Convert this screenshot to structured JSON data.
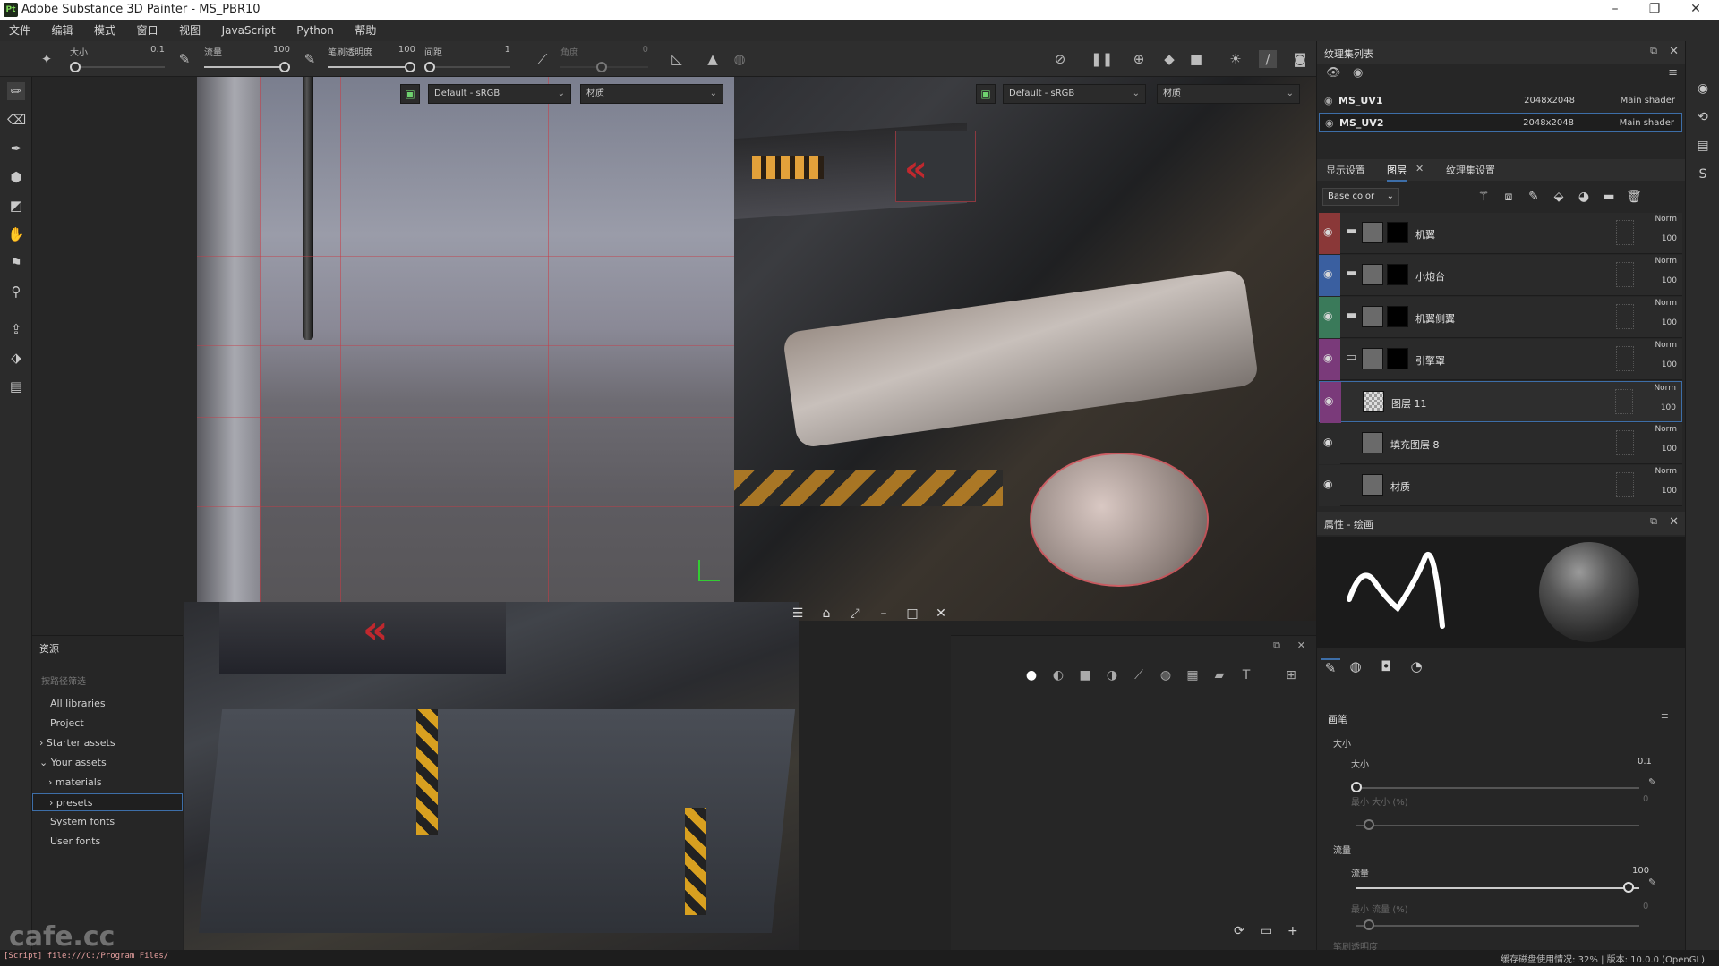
{
  "window": {
    "title": "Adobe Substance 3D Painter - MS_PBR10",
    "app_badge": "Pt",
    "min": "–",
    "max": "❐",
    "close": "✕"
  },
  "menu": [
    "文件",
    "编辑",
    "模式",
    "窗口",
    "视图",
    "JavaScript",
    "Python",
    "帮助"
  ],
  "toolbar": {
    "size_label": "大小",
    "size_value": "0.1",
    "flow_label": "流量",
    "flow_value": "100",
    "opacity_label": "笔刷透明度",
    "opacity_value": "100",
    "spacing_label": "间距",
    "spacing_value": "1",
    "angle_label": "角度",
    "angle_value": "0"
  },
  "viewport_2d": {
    "colorspace": "Default - sRGB",
    "channel": "材质"
  },
  "viewport_3d": {
    "colorspace": "Default - sRGB",
    "channel": "材质"
  },
  "assets": {
    "title": "资源",
    "filter_placeholder": "按路径筛选",
    "items": [
      "All libraries",
      "Project",
      "Starter assets",
      "Your assets",
      "materials",
      "presets",
      "System fonts",
      "User fonts"
    ]
  },
  "texture_sets": {
    "title": "纹理集列表",
    "rows": [
      {
        "name": "MS_UV1",
        "resolution": "2048x2048",
        "shader": "Main shader"
      },
      {
        "name": "MS_UV2",
        "resolution": "2048x2048",
        "shader": "Main shader"
      }
    ]
  },
  "layer_tabs": [
    "显示设置",
    "图层",
    "纹理集设置"
  ],
  "channel_select": "Base color",
  "layers": [
    {
      "name": "机翼",
      "blend": "Norm",
      "opacity": "100",
      "tag": "#8a3838",
      "type": "folder"
    },
    {
      "name": "小炮台",
      "blend": "Norm",
      "opacity": "100",
      "tag": "#3a5fa0",
      "type": "folder"
    },
    {
      "name": "机翼侧翼",
      "blend": "Norm",
      "opacity": "100",
      "tag": "#3a7a5a",
      "type": "folder"
    },
    {
      "name": "引擎罩",
      "blend": "Norm",
      "opacity": "100",
      "tag": "#7a3a7a",
      "type": "folder-open"
    },
    {
      "name": "图层 11",
      "blend": "Norm",
      "opacity": "100",
      "tag": "#7a3a7a",
      "type": "paint"
    },
    {
      "name": "填充图层 8",
      "blend": "Norm",
      "opacity": "100",
      "tag": "#2a2a2a",
      "type": "fill"
    },
    {
      "name": "材质",
      "blend": "Norm",
      "opacity": "100",
      "tag": "#2a2a2a",
      "type": "fill"
    }
  ],
  "properties": {
    "title": "属性 - 绘画",
    "section_brush": "画笔",
    "size_group": "大小",
    "size_label": "大小",
    "size_value": "0.1",
    "min_size_label": "最小 大小 (%)",
    "min_size_value": "0",
    "flow_group": "流量",
    "flow_label": "流量",
    "flow_value": "100",
    "min_flow_label": "最小 流量 (%)",
    "min_flow_value": "0",
    "opacity_group": "笔刷透明度"
  },
  "status": {
    "script": "[Script] file:///C:/Program Files/",
    "right": "缓存磁盘使用情况:   32%  |  版本: 10.0.0 (OpenGL)"
  },
  "watermark": "cafe.cc"
}
